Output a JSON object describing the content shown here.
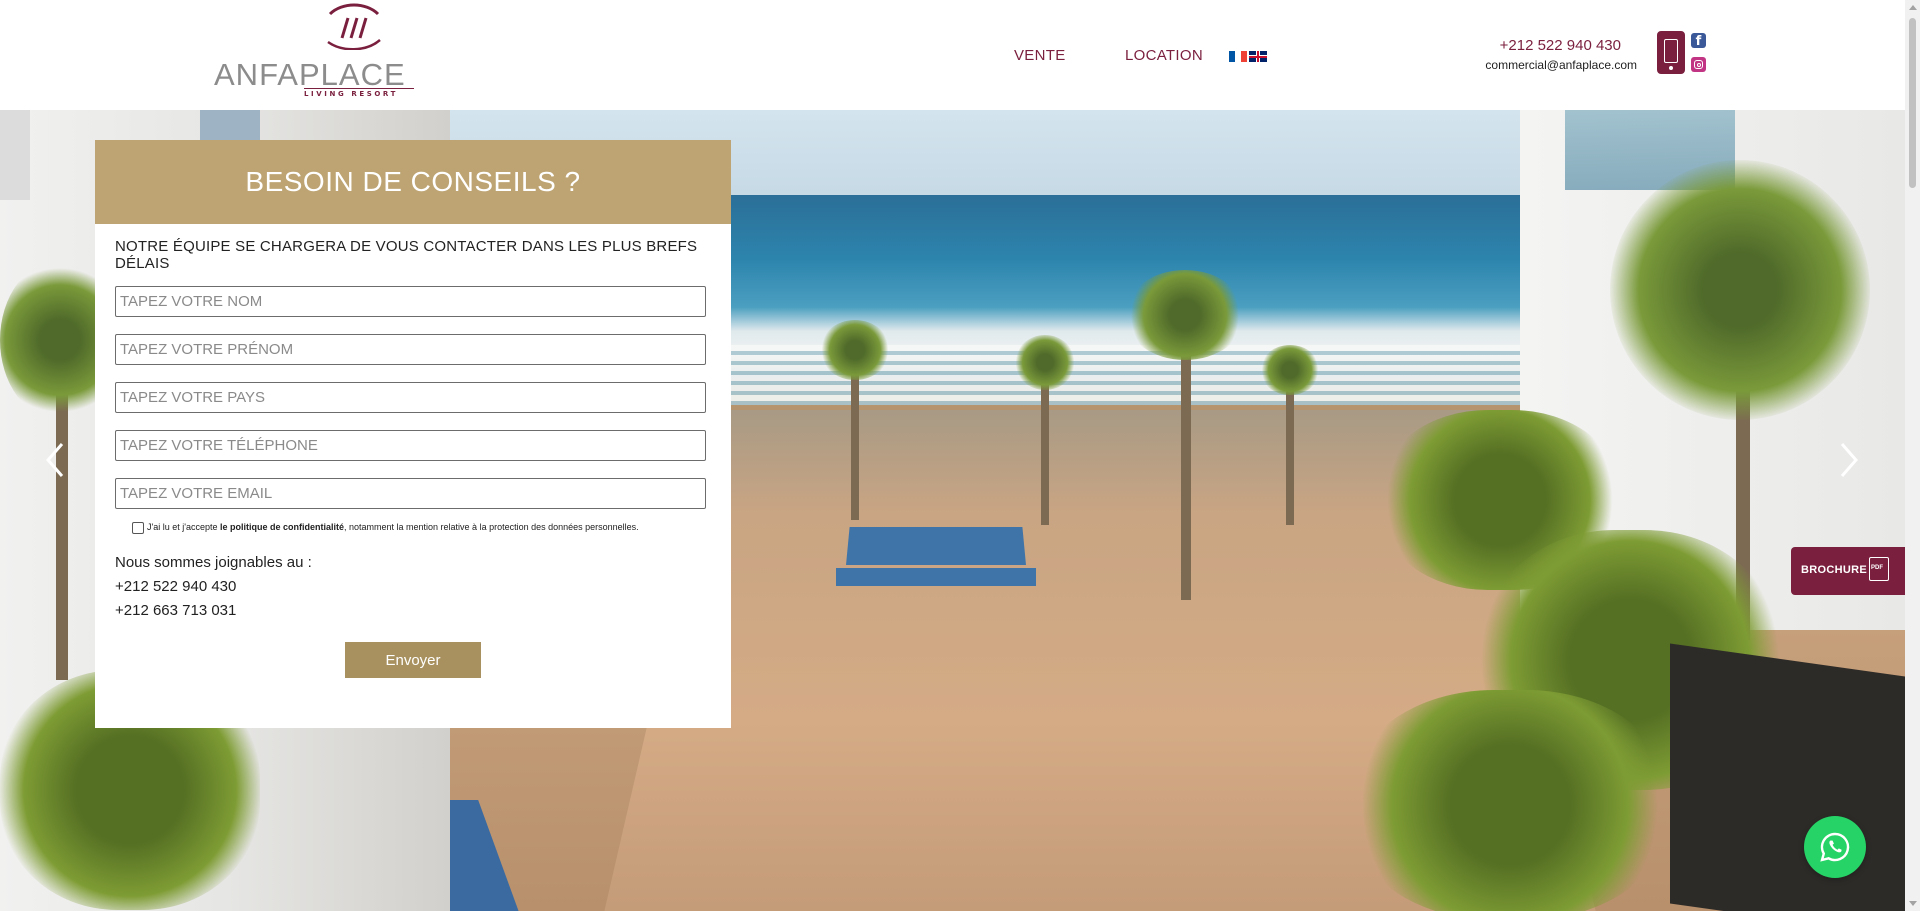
{
  "brand": {
    "name_part1": "ANFA",
    "name_part2": "PLACE",
    "tagline": "LIVING RESORT",
    "accent_color": "#7a1f3d",
    "gold_color": "#bda472"
  },
  "nav": {
    "items": [
      {
        "label": "VENTE"
      },
      {
        "label": "LOCATION"
      }
    ],
    "languages": [
      "fr",
      "en"
    ]
  },
  "contact": {
    "phone": "+212 522 940 430",
    "email": "commercial@anfaplace.com",
    "icons": [
      "mobile-phone-icon",
      "facebook-icon",
      "instagram-icon"
    ]
  },
  "form": {
    "title": "BESOIN DE CONSEILS ?",
    "intro": "NOTRE ÉQUIPE SE CHARGERA DE VOUS CONTACTER DANS LES PLUS BREFS DÉLAIS",
    "fields": {
      "name": {
        "placeholder": "TAPEZ VOTRE NOM",
        "value": ""
      },
      "firstname": {
        "placeholder": "TAPEZ VOTRE PRÉNOM",
        "value": ""
      },
      "country": {
        "placeholder": "TAPEZ VOTRE PAYS",
        "value": ""
      },
      "phone": {
        "placeholder": "TAPEZ VOTRE TÉLÉPHONE",
        "value": ""
      },
      "email": {
        "placeholder": "TAPEZ VOTRE EMAIL",
        "value": ""
      }
    },
    "consent": {
      "before": "J'ai lu et j'accepte ",
      "link": "le politique de confidentialité",
      "after": ", notamment la mention relative à la protection des données personnelles.",
      "checked": false
    },
    "reach_title": "Nous sommes joignables au :",
    "reach_phone1": "+212 522 940 430",
    "reach_phone2": "+212 663 713 031",
    "submit_label": "Envoyer"
  },
  "brochure": {
    "label": "BROCHURE",
    "file_type": "PDF"
  }
}
